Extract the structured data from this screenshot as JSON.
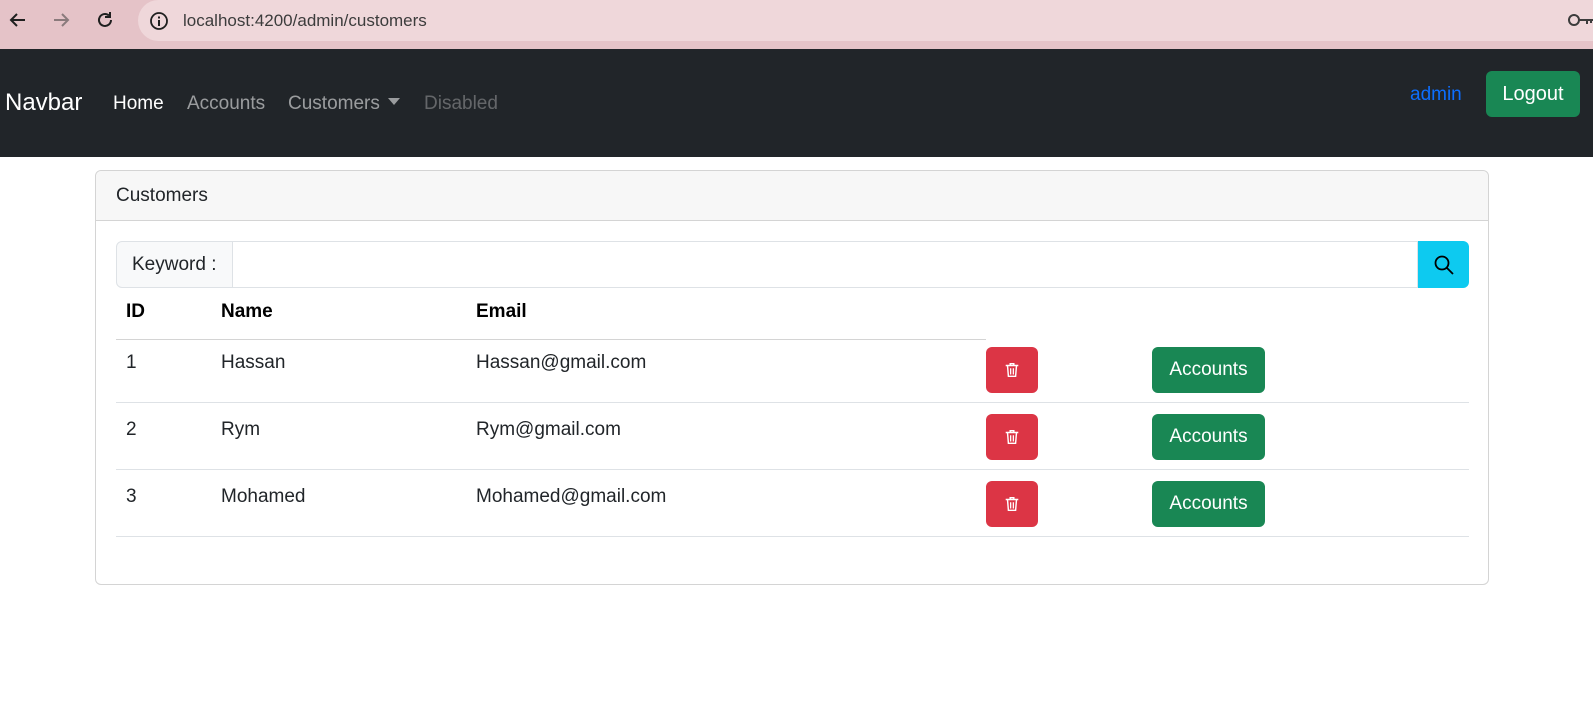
{
  "browser": {
    "url": "localhost:4200/admin/customers",
    "back_icon": "arrow-left-icon",
    "forward_icon": "arrow-right-icon",
    "reload_icon": "reload-icon",
    "info_icon": "info-icon",
    "key_icon": "key-icon"
  },
  "navbar": {
    "brand": "Navbar",
    "links": [
      {
        "label": "Home"
      },
      {
        "label": "Accounts"
      },
      {
        "label": "Customers"
      },
      {
        "label": "Disabled"
      }
    ],
    "user": "admin",
    "logout_label": "Logout"
  },
  "card": {
    "title": "Customers",
    "search": {
      "label": "Keyword :",
      "value": "",
      "placeholder": ""
    }
  },
  "table": {
    "headers": [
      "ID",
      "Name",
      "Email"
    ],
    "rows": [
      {
        "id": "1",
        "name": "Hassan",
        "email": "Hassan@gmail.com",
        "action_label": "Accounts"
      },
      {
        "id": "2",
        "name": "Rym",
        "email": "Rym@gmail.com",
        "action_label": "Accounts"
      },
      {
        "id": "3",
        "name": "Mohamed",
        "email": "Mohamed@gmail.com",
        "action_label": "Accounts"
      }
    ]
  },
  "colors": {
    "navbar_bg": "#212529",
    "danger": "#dc3545",
    "success": "#198754",
    "info": "#0dcaf0",
    "primary": "#0d6efd"
  }
}
